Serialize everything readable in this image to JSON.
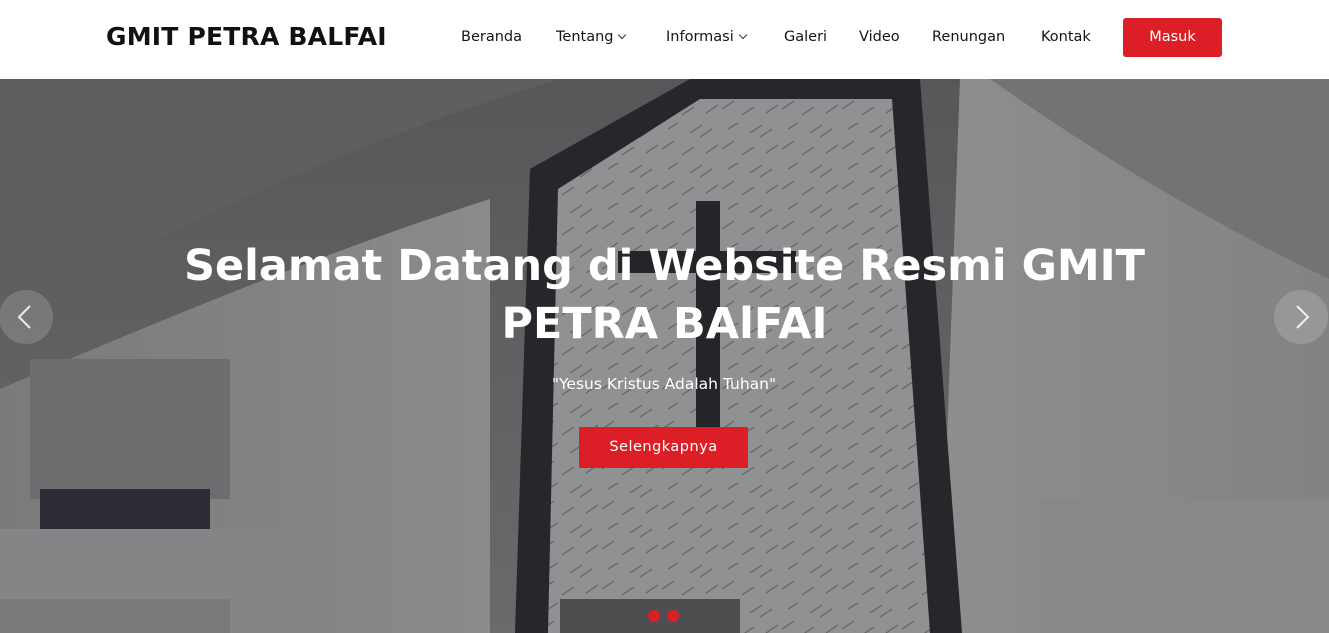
{
  "header": {
    "logo": "GMIT PETRA BALFAI",
    "nav": [
      {
        "label": "Beranda",
        "has_dropdown": false
      },
      {
        "label": "Tentang",
        "has_dropdown": true
      },
      {
        "label": "Informasi",
        "has_dropdown": true
      },
      {
        "label": "Galeri",
        "has_dropdown": false
      },
      {
        "label": "Video",
        "has_dropdown": false
      },
      {
        "label": "Renungan",
        "has_dropdown": false
      },
      {
        "label": "Kontak",
        "has_dropdown": false
      }
    ],
    "login_label": "Masuk"
  },
  "hero": {
    "title": "Selamat Datang di Website Resmi GMIT PETRA BAlFAI",
    "subtitle": "\"Yesus Kristus Adalah Tuhan\"",
    "button_label": "Selengkapnya",
    "prev_icon": "chevron-left-icon",
    "next_icon": "chevron-right-icon",
    "slide_count": 2,
    "active_slide": 1
  },
  "colors": {
    "accent": "#dc1f26",
    "header_bg": "#ffffff",
    "logo_text": "#111111",
    "hero_text": "#ffffff"
  }
}
